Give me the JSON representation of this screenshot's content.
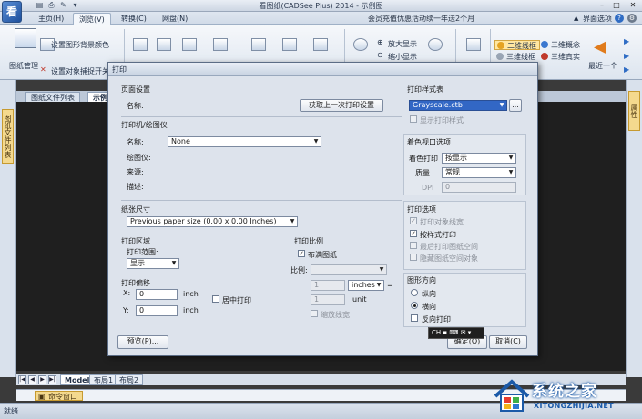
{
  "window": {
    "title": "看图纸(CADSee Plus) 2014 - 示例图",
    "logo": "看"
  },
  "ribbon_tabs": [
    "主页(H)",
    "浏览(V)",
    "转换(C)",
    "网盘(N)"
  ],
  "notice": "会员充值优惠活动续一年送2个月",
  "mode_select": "界面选项",
  "ribbon": {
    "drawing_mgmt": "图纸管理",
    "bg_color": "设置图形背景颜色",
    "snap": "设置对象捕捉开关",
    "zoom_in": "放大显示",
    "zoom_out": "缩小显示",
    "view_2d_line": "二维线框",
    "view_3d_concept": "三维概念",
    "view_3d_wire": "三维线框",
    "view_3d_real": "三维真实",
    "last_one": "最近一个"
  },
  "doc_tabs": [
    "图纸文件列表",
    "示例图"
  ],
  "left_panel_tab": "图纸文件列表",
  "right_panel_tab": "属性",
  "layout_tabs": [
    "Model",
    "布局1",
    "布局2"
  ],
  "command_window": "命令窗口",
  "status_text": "就绪",
  "watermark": {
    "title": "系统之家",
    "url": "XITONGZHIJIA.NET"
  },
  "ime_bar": "CH",
  "dialog": {
    "title": "打印",
    "page_setup": {
      "heading": "页面设置",
      "name_label": "名称:",
      "fetch_button": "获取上一次打印设置"
    },
    "printer": {
      "heading": "打印机/绘图仪",
      "name_label": "名称:",
      "name_value": "None",
      "plotter_label": "绘图仪:",
      "location_label": "来源:",
      "description_label": "描述:"
    },
    "paper": {
      "heading": "纸张尺寸",
      "value": "Previous paper size (0.00 x 0.00 Inches)"
    },
    "print_area": {
      "heading": "打印区域",
      "range_label": "打印范围:",
      "range_value": "显示"
    },
    "offset": {
      "heading": "打印偏移",
      "x_label": "X:",
      "x_value": "0",
      "y_label": "Y:",
      "y_value": "0",
      "unit": "inch",
      "center_label": "居中打印"
    },
    "scale": {
      "heading": "打印比例",
      "fit_label": "布满图纸",
      "ratio_label": "比例:",
      "val1": "1",
      "unit_select": "inches",
      "val2": "1",
      "unit_label": "unit",
      "lineweight_label": "缩放线宽"
    },
    "style_table": {
      "heading": "打印样式表",
      "value": "Grayscale.ctb",
      "more_button": "...",
      "show_label": "显示打印样式"
    },
    "shaded": {
      "heading": "着色视口选项",
      "shade_label": "着色打印",
      "shade_value": "按显示",
      "quality_label": "质量",
      "quality_value": "常规",
      "dpi_label": "DPI",
      "dpi_value": "0"
    },
    "options": {
      "heading": "打印选项",
      "opt1": "打印对象线宽",
      "opt2": "按样式打印",
      "opt3": "最后打印图纸空间",
      "opt4": "隐藏图纸空间对象"
    },
    "orientation": {
      "heading": "图形方向",
      "portrait": "纵向",
      "landscape": "横向",
      "reverse": "反向打印"
    },
    "preview_button": "预览(P)...",
    "ok_button": "确定(O)",
    "cancel_button": "取消(C)"
  }
}
